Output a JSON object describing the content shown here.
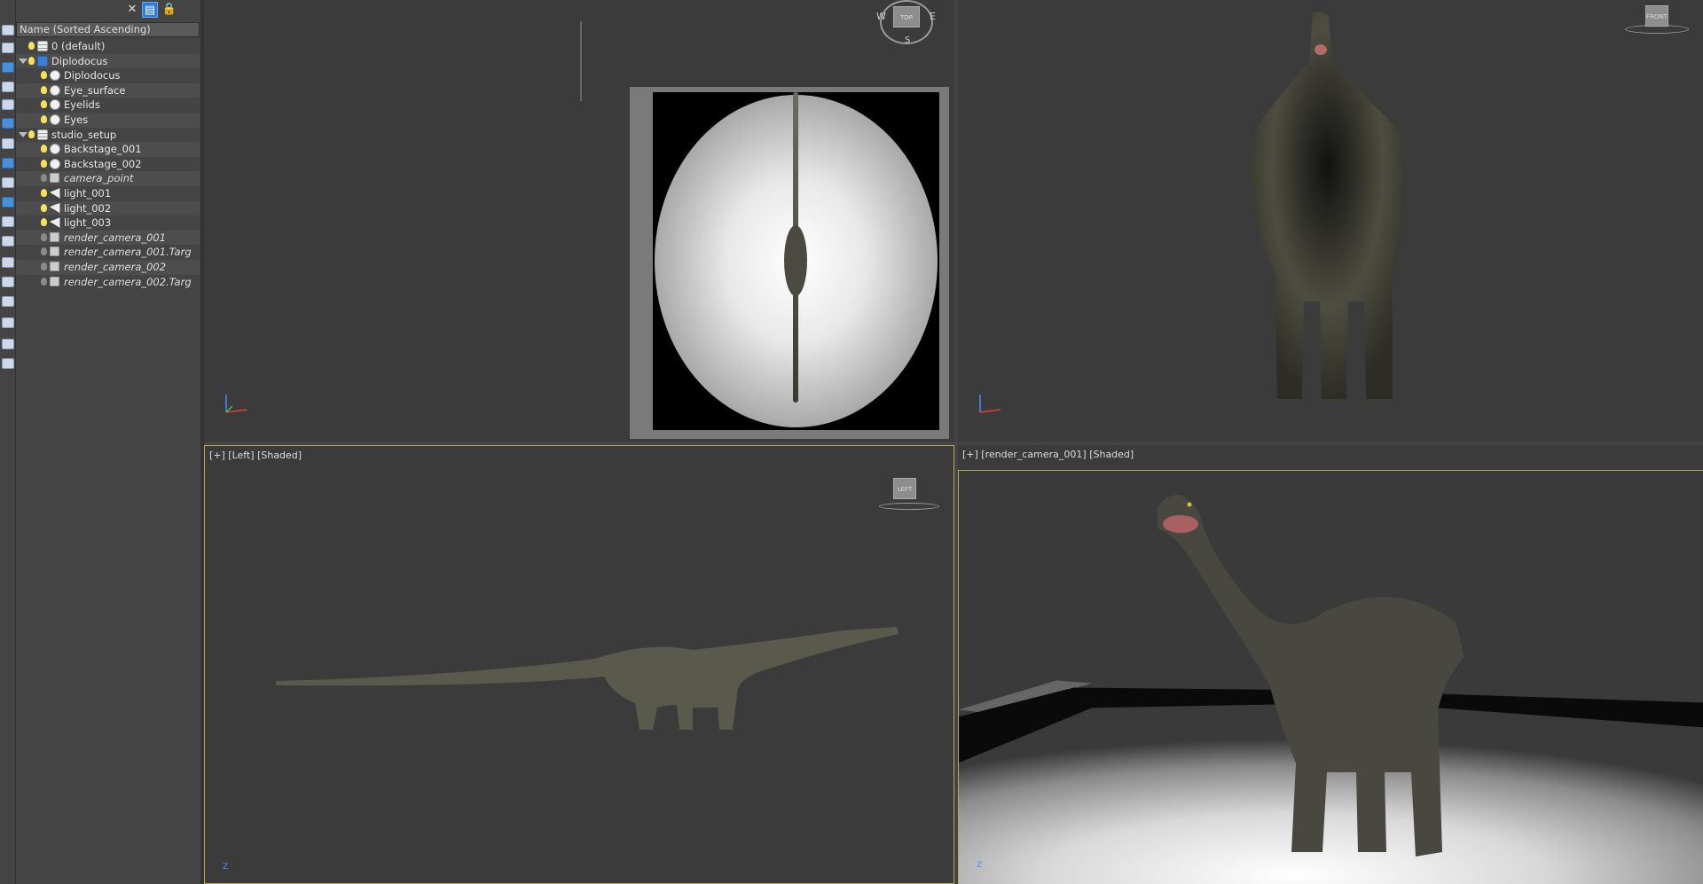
{
  "explorer": {
    "close_icon": "close-icon",
    "header": "Name (Sorted Ascending)",
    "rows": [
      {
        "label": "0 (default)",
        "indent": 0,
        "icon": "layer",
        "bulb": "on",
        "arrow": false,
        "italic": false
      },
      {
        "label": "Diplodocus",
        "indent": 0,
        "icon": "layer-blue",
        "bulb": "on",
        "arrow": true,
        "italic": false
      },
      {
        "label": "Diplodocus",
        "indent": 1,
        "icon": "sphere",
        "bulb": "on",
        "arrow": false,
        "italic": false
      },
      {
        "label": "Eye_surface",
        "indent": 1,
        "icon": "sphere",
        "bulb": "on",
        "arrow": false,
        "italic": false
      },
      {
        "label": "Eyelids",
        "indent": 1,
        "icon": "sphere",
        "bulb": "on",
        "arrow": false,
        "italic": false
      },
      {
        "label": "Eyes",
        "indent": 1,
        "icon": "sphere",
        "bulb": "on",
        "arrow": false,
        "italic": false
      },
      {
        "label": "studio_setup",
        "indent": 0,
        "icon": "layer",
        "bulb": "on",
        "arrow": true,
        "italic": false
      },
      {
        "label": "Backstage_001",
        "indent": 1,
        "icon": "sphere",
        "bulb": "on",
        "arrow": false,
        "italic": false
      },
      {
        "label": "Backstage_002",
        "indent": 1,
        "icon": "sphere",
        "bulb": "on",
        "arrow": false,
        "italic": false
      },
      {
        "label": "camera_point",
        "indent": 1,
        "icon": "camera",
        "bulb": "off",
        "arrow": false,
        "italic": true
      },
      {
        "label": "light_001",
        "indent": 1,
        "icon": "light",
        "bulb": "on",
        "arrow": false,
        "italic": false
      },
      {
        "label": "light_002",
        "indent": 1,
        "icon": "light",
        "bulb": "on",
        "arrow": false,
        "italic": false
      },
      {
        "label": "light_003",
        "indent": 1,
        "icon": "light",
        "bulb": "on",
        "arrow": false,
        "italic": false
      },
      {
        "label": "render_camera_001",
        "indent": 1,
        "icon": "camera",
        "bulb": "off",
        "arrow": false,
        "italic": true
      },
      {
        "label": "render_camera_001.Targ",
        "indent": 1,
        "icon": "camera",
        "bulb": "off",
        "arrow": false,
        "italic": true
      },
      {
        "label": "render_camera_002",
        "indent": 1,
        "icon": "camera",
        "bulb": "off",
        "arrow": false,
        "italic": true
      },
      {
        "label": "render_camera_002.Targ",
        "indent": 1,
        "icon": "camera",
        "bulb": "off",
        "arrow": false,
        "italic": true
      }
    ]
  },
  "viewports": {
    "top": {
      "label": "",
      "cube": "TOP",
      "compass": {
        "w": "W",
        "e": "E",
        "s": "S"
      }
    },
    "front": {
      "label": "",
      "cube": "FRONT"
    },
    "left": {
      "label": "[+] [Left] [Shaded]",
      "cube": "LEFT"
    },
    "camera": {
      "label": "[+] [render_camera_001] [Shaded]"
    }
  },
  "axes": {
    "z": "Z"
  },
  "colors": {
    "active_border": "#b8a94a",
    "toggle_active": "#2c7bd6",
    "bulb_on": "#f5e15a"
  }
}
